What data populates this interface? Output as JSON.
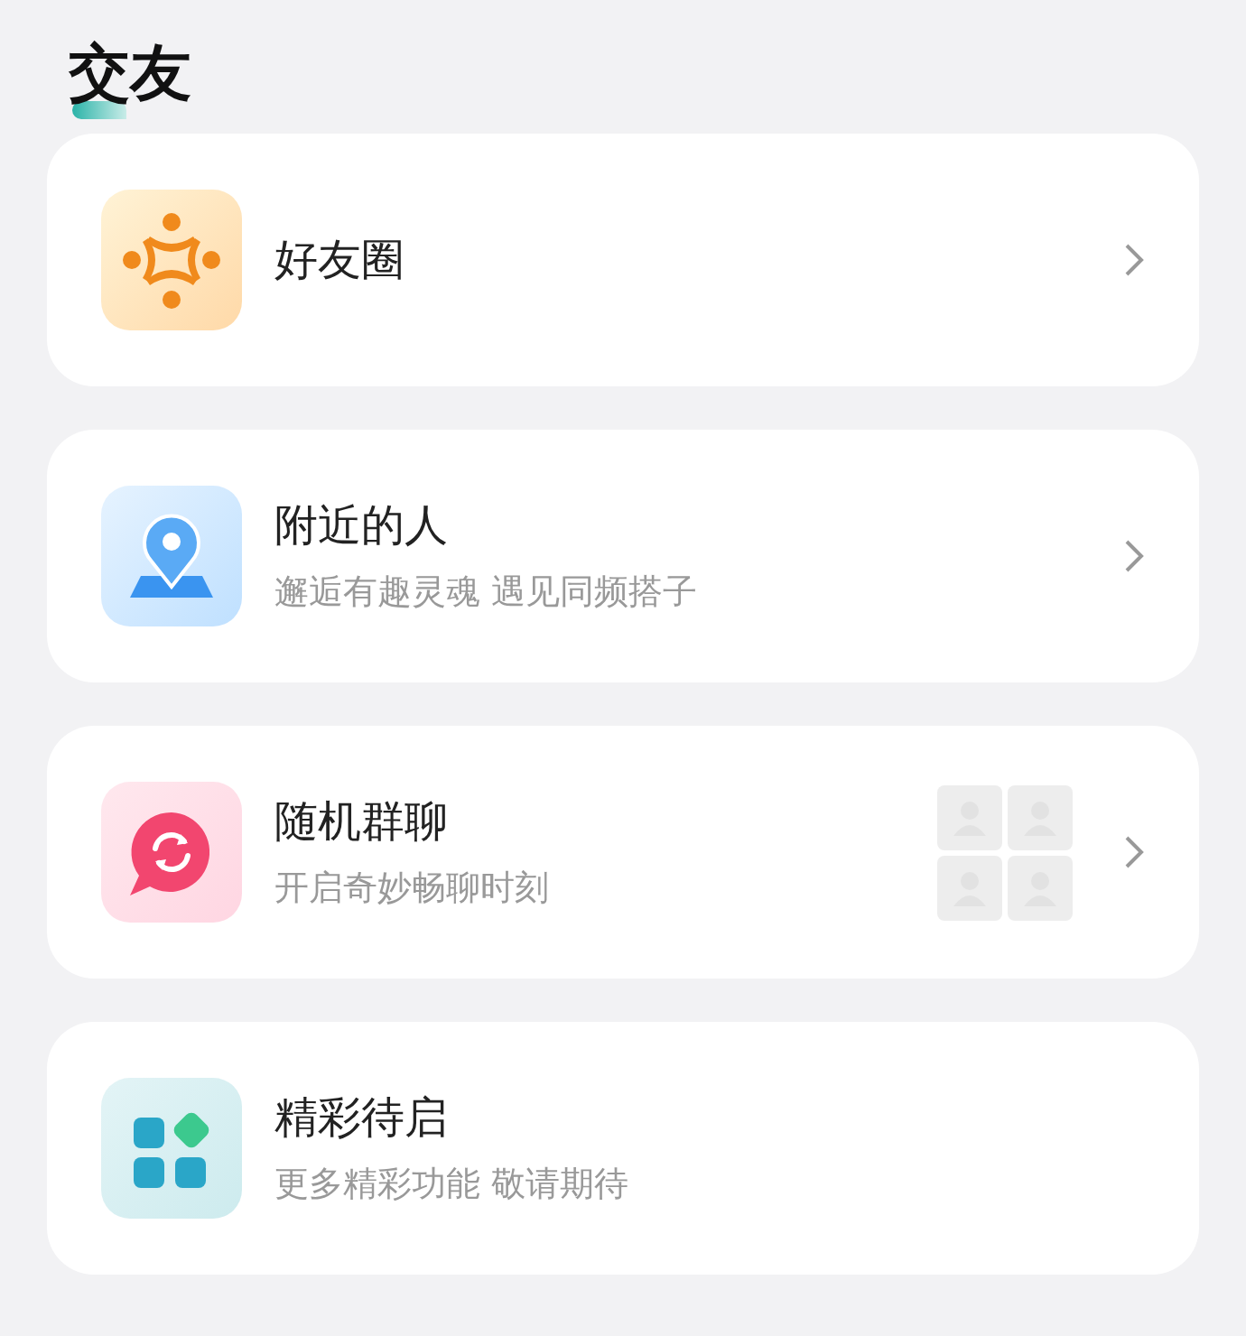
{
  "section": {
    "title": "交友"
  },
  "items": [
    {
      "kind": "friends",
      "title": "好友圈",
      "chevron": true,
      "avatar_grid": false
    },
    {
      "kind": "location",
      "title": "附近的人",
      "subtitle": "邂逅有趣灵魂 遇见同频搭子",
      "chevron": true,
      "avatar_grid": false
    },
    {
      "kind": "chat",
      "title": "随机群聊",
      "subtitle": "开启奇妙畅聊时刻",
      "chevron": true,
      "avatar_grid": true
    },
    {
      "kind": "apps",
      "title": "精彩待启",
      "subtitle": "更多精彩功能 敬请期待",
      "chevron": false,
      "avatar_grid": false
    }
  ]
}
